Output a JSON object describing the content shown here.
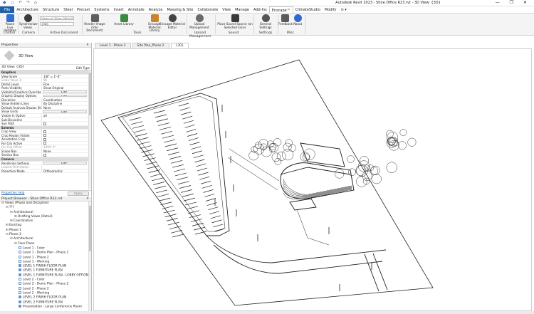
{
  "window": {
    "title": "Autodesk Revit 2023 - Stine Office R23.rvt - 3D View: {3D}",
    "controls": "— ❐ ✕"
  },
  "menu": {
    "tabs": [
      "File",
      "Architecture",
      "Structure",
      "Steel",
      "Precast",
      "Systems",
      "Insert",
      "Annotate",
      "Analyze",
      "Massing & Site",
      "Collaborate",
      "View",
      "Manage",
      "Add-Ins",
      "Enscape™",
      "ClimateStudio",
      "Modify",
      "⊙ ▾"
    ],
    "active_index": 14
  },
  "ribbon": {
    "view_combo_placeholder": "Views of \"Stine Office R23\"",
    "view_combo_value": "{3D}",
    "buttons": {
      "pause": "Pause Live Updates",
      "sync": "Synchronize Views",
      "render": "Render Image (Into Document)",
      "asset": "Asset Library",
      "material": "Enscape Material Library",
      "editor": "Enscape Material Editor",
      "upload": "Upload Management",
      "sound": "Place Sound Source (on Selected Face)",
      "settings": "General Settings",
      "feedback": "Feedback",
      "about": "About"
    },
    "panels": {
      "control": "Control",
      "camera": "Camera",
      "active_doc": "Active Document",
      "tools": "Tools",
      "upload": "Upload Management",
      "sound": "Sound",
      "settings": "Settings",
      "misc": "Misc"
    }
  },
  "properties": {
    "header": "Properties",
    "type_name": "3D View",
    "selector": "3D View: {3D}",
    "edit_type": "Edit Type",
    "rows": [
      {
        "k": "Graphics",
        "v": "",
        "kind": "grp"
      },
      {
        "k": "View Scale",
        "v": "1/8\" = 1'-0\"",
        "kind": "field"
      },
      {
        "k": "Scale Value    1:",
        "v": "96",
        "kind": "dim"
      },
      {
        "k": "Detail Level",
        "v": "Fine",
        "kind": "plain"
      },
      {
        "k": "Parts Visibility",
        "v": "Show Original",
        "kind": "plain"
      },
      {
        "k": "Visibility/Graphics Overrides",
        "v": "Edit...",
        "kind": "btn"
      },
      {
        "k": "Graphic Display Options",
        "v": "Edit...",
        "kind": "btn"
      },
      {
        "k": "Discipline",
        "v": "Coordination",
        "kind": "plain"
      },
      {
        "k": "Show Hidden Lines",
        "v": "By Discipline",
        "kind": "plain"
      },
      {
        "k": "Default Analysis Display Style",
        "v": "None",
        "kind": "plain"
      },
      {
        "k": "Show Grids",
        "v": "Edit...",
        "kind": "btn"
      },
      {
        "k": "Visible In Option",
        "v": "all",
        "kind": "plain"
      },
      {
        "k": "Sub-Discipline",
        "v": "",
        "kind": "plain"
      },
      {
        "k": "Sun Path",
        "v": "",
        "kind": "cb"
      },
      {
        "k": "Extents",
        "v": "",
        "kind": "grp"
      },
      {
        "k": "Crop View",
        "v": "",
        "kind": "cb"
      },
      {
        "k": "Crop Region Visible",
        "v": "",
        "kind": "cb"
      },
      {
        "k": "Annotation Crop",
        "v": "",
        "kind": "cb"
      },
      {
        "k": "Far Clip Active",
        "v": "",
        "kind": "cb"
      },
      {
        "k": "Far Clip Offset",
        "v": "1000' 0\"",
        "kind": "dim"
      },
      {
        "k": "Scope Box",
        "v": "None",
        "kind": "plain"
      },
      {
        "k": "Section Box",
        "v": "",
        "kind": "cb"
      },
      {
        "k": "Camera",
        "v": "",
        "kind": "grp"
      },
      {
        "k": "Rendering Settings",
        "v": "Edit...",
        "kind": "btn"
      },
      {
        "k": "Locked Orientation",
        "v": "",
        "kind": "dim"
      },
      {
        "k": "Projection Mode",
        "v": "Orthographic",
        "kind": "plain"
      }
    ],
    "help_link": "Properties help",
    "apply": "Apply"
  },
  "browser": {
    "header": "Project Browser - Stine Office R23.rvt",
    "items": [
      {
        "label": "Views (Phase and Discipline)",
        "depth": 0,
        "toggle": "⊟",
        "icon": "fold"
      },
      {
        "label": "???",
        "depth": 1,
        "toggle": "⊟",
        "icon": ""
      },
      {
        "label": "Architectural",
        "depth": 2,
        "toggle": "⊟",
        "icon": ""
      },
      {
        "label": "Drafting Views (Detail)",
        "depth": 3,
        "toggle": "⊞",
        "icon": ""
      },
      {
        "label": "Coordination",
        "depth": 2,
        "toggle": "⊞",
        "icon": ""
      },
      {
        "label": "Existing",
        "depth": 1,
        "toggle": "⊞",
        "icon": ""
      },
      {
        "label": "Phase 1",
        "depth": 1,
        "toggle": "⊞",
        "icon": ""
      },
      {
        "label": "Phase 2",
        "depth": 1,
        "toggle": "⊟",
        "icon": ""
      },
      {
        "label": "Architectural",
        "depth": 2,
        "toggle": "⊟",
        "icon": ""
      },
      {
        "label": "Floor Plans",
        "depth": 3,
        "toggle": "⊟",
        "icon": ""
      },
      {
        "label": "Level 1 - Color",
        "depth": 4,
        "toggle": "",
        "icon": "doc"
      },
      {
        "label": "Level 1 - Demo Plan - Phase 2",
        "depth": 4,
        "toggle": "",
        "icon": "doc"
      },
      {
        "label": "Level 1 - Phase 2",
        "depth": 4,
        "toggle": "",
        "icon": "doc"
      },
      {
        "label": "Level 1 - Working",
        "depth": 4,
        "toggle": "",
        "icon": "doc"
      },
      {
        "label": "LEVEL 1 FINISH FLOOR PLAN",
        "depth": 4,
        "toggle": "",
        "icon": "blue"
      },
      {
        "label": "LEVEL 1 FURNITURE PLAN",
        "depth": 4,
        "toggle": "",
        "icon": "blue"
      },
      {
        "label": "LEVEL 1 FURNITURE PLAN - LOBBY OPTION",
        "depth": 4,
        "toggle": "",
        "icon": "blue"
      },
      {
        "label": "Level 2 - Color",
        "depth": 4,
        "toggle": "",
        "icon": "doc"
      },
      {
        "label": "Level 2 - Demo Plan - Phase 2",
        "depth": 4,
        "toggle": "",
        "icon": "doc"
      },
      {
        "label": "Level 2 - Phase 2",
        "depth": 4,
        "toggle": "",
        "icon": "doc"
      },
      {
        "label": "Level 2 - Working",
        "depth": 4,
        "toggle": "",
        "icon": "doc"
      },
      {
        "label": "LEVEL 2 FINISH FLOOR PLAN",
        "depth": 4,
        "toggle": "",
        "icon": "blue"
      },
      {
        "label": "LEVEL 2 FURNITURE PLAN",
        "depth": 4,
        "toggle": "",
        "icon": "blue"
      },
      {
        "label": "Presentation - Large Conference Room",
        "depth": 4,
        "toggle": "",
        "icon": "blue"
      }
    ]
  },
  "view_tabs": [
    {
      "label": "Level 1 - Phase 2",
      "active": false
    },
    {
      "label": "Site Plan_Phase 2",
      "active": false
    },
    {
      "label": "{3D}",
      "active": true
    }
  ]
}
